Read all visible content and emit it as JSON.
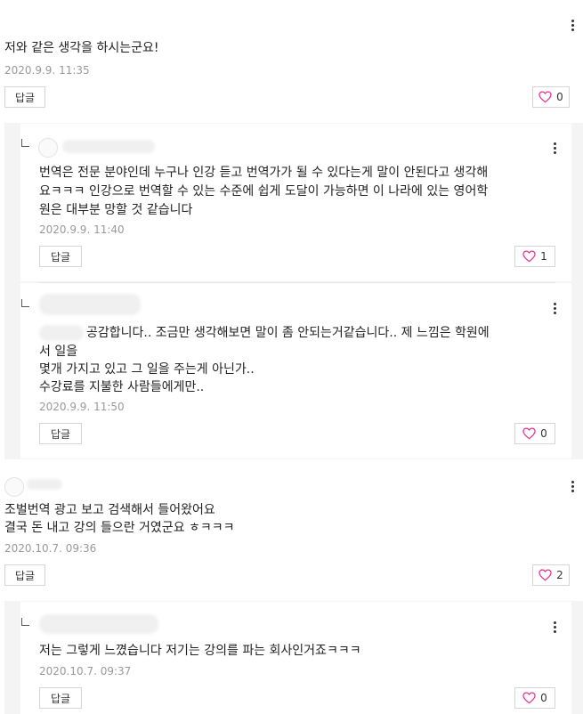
{
  "comments": [
    {
      "text_lines": [
        "저와 같은 생각을 하시는군요!"
      ],
      "date": "2020.9.9. 11:35",
      "reply_label": "답글",
      "likes": "0",
      "liked": false,
      "replies": [
        {
          "text_lines": [
            "번역은 전문 분야인데 누구나 인강 듣고 번역가가 될 수 있다는게 말이 안된다고 생각해",
            "요ㅋㅋㅋ 인강으로 번역할 수 있는 수준에 쉽게 도달이 가능하면 이 나라에 있는 영어학",
            "원은 대부분 망할 것 같습니다"
          ],
          "date": "2020.9.9. 11:40",
          "reply_label": "답글",
          "likes": "1"
        },
        {
          "text_lines": [
            "공감합니다.. 조금만 생각해보면 말이 좀 안되는거같습니다.. 제 느낌은 학원에",
            "서 일을",
            "몇개 가지고 있고 그 일을 주는게 아닌가..",
            "수강료를 지불한 사람들에게만.."
          ],
          "date": "2020.9.9. 11:50",
          "reply_label": "답글",
          "likes": "0"
        }
      ]
    },
    {
      "text_lines": [
        "조벌번역 광고 보고 검색해서 들어왔어요",
        "결국 돈 내고 강의 들으란 거였군요 ㅎㅋㅋㅋ"
      ],
      "date": "2020.10.7. 09:36",
      "reply_label": "답글",
      "likes": "2",
      "replies": [
        {
          "text_lines": [
            "저는 그렇게 느꼈습니다 저기는 강의를 파는 회사인거죠ㅋㅋㅋ"
          ],
          "date": "2020.10.7. 09:37",
          "reply_label": "답글",
          "likes": "0"
        }
      ]
    }
  ],
  "colors": {
    "heart": "#e8338f",
    "reply_bg": "#f4f4f4",
    "border": "#d5d5d5",
    "date": "#999999"
  },
  "icons": {
    "more": "more-vertical-icon",
    "like": "heart-outline-icon",
    "reply_indent": "reply-corner-icon"
  }
}
